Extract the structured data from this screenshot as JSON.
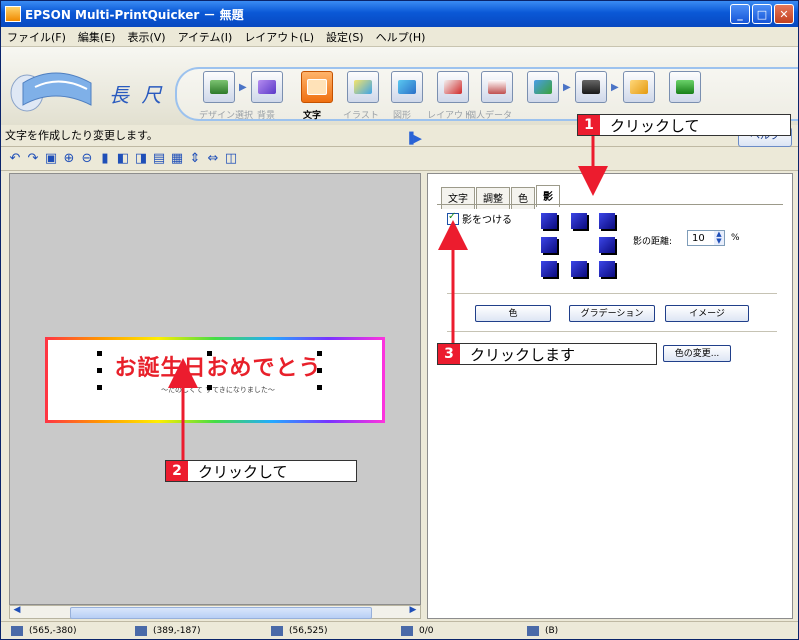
{
  "window": {
    "title": "EPSON Multi-PrintQuicker － 無題"
  },
  "menu": [
    "ファイル(F)",
    "編集(E)",
    "表示(V)",
    "アイテム(I)",
    "レイアウト(L)",
    "設定(S)",
    "ヘルプ(H)"
  ],
  "app": {
    "logo_text": "長 尺"
  },
  "tools": [
    {
      "label": "デザイン選択"
    },
    {
      "label": "背景"
    },
    {
      "label": "文字"
    },
    {
      "label": "イラスト"
    },
    {
      "label": "図形"
    },
    {
      "label": "レイアウト"
    },
    {
      "label": "個人データ"
    }
  ],
  "status_line": {
    "text": "文字を作成したり変更します。",
    "help_label": "ヘルプ"
  },
  "canvas": {
    "title": "お誕生日おめでとう",
    "subtitle": "～たのしくて すてきになりました～"
  },
  "panel": {
    "tabs": [
      "文字",
      "調整",
      "色",
      "影"
    ],
    "active_tab": "影",
    "shadow_checkbox": "影をつける",
    "distance_label": "影の距離:",
    "distance_value": "10",
    "distance_unit": "%",
    "color_button": "色",
    "gradation_button": "グラデーション",
    "image_button": "イメージ",
    "change_color_button": "色の変更..."
  },
  "callouts": [
    {
      "num": "1",
      "text": "クリックして"
    },
    {
      "num": "2",
      "text": "クリックして"
    },
    {
      "num": "3",
      "text": "クリックします"
    }
  ],
  "statusbar": [
    "(565,-380)",
    "(389,-187)",
    "(56,525)",
    "0/0",
    "(B)"
  ],
  "colors": {
    "accent_red": "#ec1c2e",
    "title_blue": "#0a58d6",
    "active_tool": "#ef6f10"
  }
}
